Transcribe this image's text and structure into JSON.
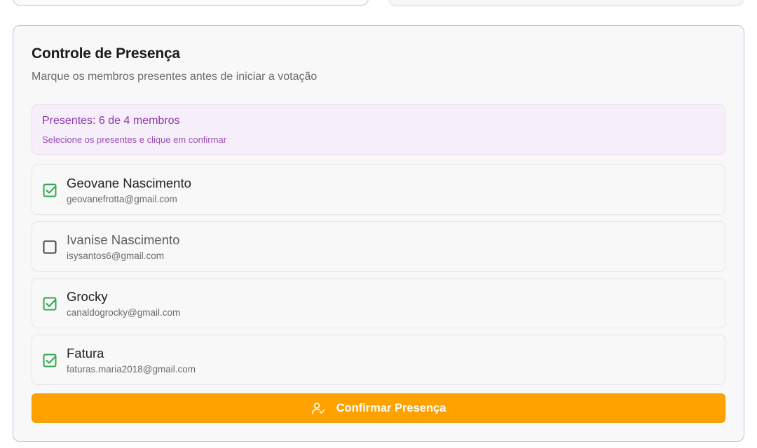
{
  "attendance": {
    "title": "Controle de Presença",
    "subtitle": "Marque os membros presentes antes de iniciar a votação",
    "summary": {
      "count_text": "Presentes: 6 de 4 membros",
      "hint": "Selecione os presentes e clique em confirmar"
    },
    "members": [
      {
        "name": "Geovane Nascimento",
        "email": "geovanefrotta@gmail.com",
        "checked": true
      },
      {
        "name": "Ivanise Nascimento",
        "email": "isysantos6@gmail.com",
        "checked": false
      },
      {
        "name": "Grocky",
        "email": "canaldogrocky@gmail.com",
        "checked": true
      },
      {
        "name": "Fatura",
        "email": "faturas.maria2018@gmail.com",
        "checked": true
      }
    ],
    "confirm_label": "Confirmar Presença",
    "confirm_icon": "user-check-icon"
  },
  "colors": {
    "accent_orange": "#ffa200",
    "purple": "#8b36a8",
    "panel_border": "#d3b3e2",
    "check_green": "#2ea84f"
  }
}
